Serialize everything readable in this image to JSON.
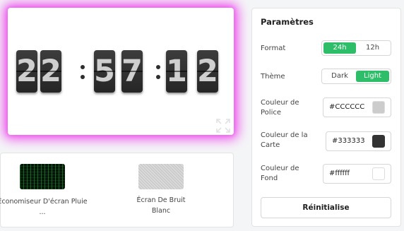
{
  "clock": {
    "digits": [
      "2",
      "2",
      "5",
      "7",
      "1",
      "2"
    ],
    "digit_color": "#CCCCCC",
    "card_color": "#333333",
    "glow_color": "#ee55ee"
  },
  "screensavers": [
    {
      "label": "Économiseur D'écran Pluie ...",
      "icon": "matrix-rain-thumbnail"
    },
    {
      "label": "Écran De Bruit Blanc",
      "icon": "white-noise-thumbnail"
    }
  ],
  "settings": {
    "title": "Paramètres",
    "format": {
      "label": "Format",
      "options": [
        "24h",
        "12h"
      ],
      "selected": "24h"
    },
    "theme": {
      "label": "Thème",
      "options": [
        "Dark",
        "Light"
      ],
      "selected": "Light"
    },
    "font_color": {
      "label": "Couleur de Police",
      "value": "#CCCCCC"
    },
    "card_color": {
      "label": "Couleur de la Carte",
      "value": "#333333"
    },
    "bg_color": {
      "label": "Couleur de Fond",
      "value": "#ffffff"
    },
    "reset_label": "Réinitialise"
  },
  "accent_color": "#2ebe6a"
}
